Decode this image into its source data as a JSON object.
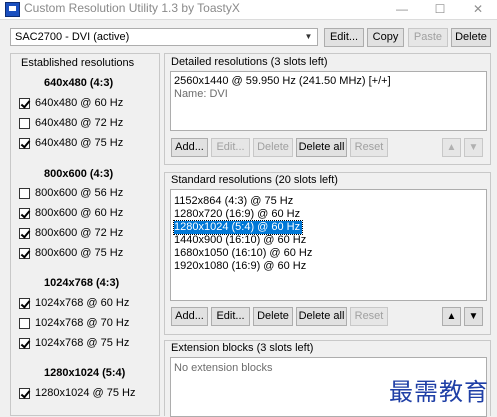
{
  "window": {
    "title": "Custom Resolution Utility 1.3 by ToastyX",
    "controls": {
      "minimize": "—",
      "maximize": "☐",
      "close": "✕"
    }
  },
  "display_select": {
    "value": "SAC2700 - DVI (active)"
  },
  "top_buttons": {
    "edit": "Edit...",
    "copy": "Copy",
    "paste": "Paste",
    "delete": "Delete"
  },
  "established": {
    "title": "Established resolutions",
    "groups": [
      {
        "heading": "640x480 (4:3)",
        "items": [
          {
            "label": "640x480 @ 60 Hz",
            "checked": true
          },
          {
            "label": "640x480 @ 72 Hz",
            "checked": false
          },
          {
            "label": "640x480 @ 75 Hz",
            "checked": true
          }
        ]
      },
      {
        "heading": "800x600 (4:3)",
        "items": [
          {
            "label": "800x600 @ 56 Hz",
            "checked": false
          },
          {
            "label": "800x600 @ 60 Hz",
            "checked": true
          },
          {
            "label": "800x600 @ 72 Hz",
            "checked": true
          },
          {
            "label": "800x600 @ 75 Hz",
            "checked": true
          }
        ]
      },
      {
        "heading": "1024x768 (4:3)",
        "items": [
          {
            "label": "1024x768 @ 60 Hz",
            "checked": true
          },
          {
            "label": "1024x768 @ 70 Hz",
            "checked": false
          },
          {
            "label": "1024x768 @ 75 Hz",
            "checked": true
          }
        ]
      },
      {
        "heading": "1280x1024 (5:4)",
        "items": [
          {
            "label": "1280x1024 @ 75 Hz",
            "checked": true
          }
        ]
      }
    ]
  },
  "detailed": {
    "title": "Detailed resolutions (3 slots left)",
    "lines": [
      "2560x1440 @ 59.950 Hz (241.50 MHz) [+/+]",
      "Name: DVI"
    ],
    "buttons": {
      "add": "Add...",
      "edit": "Edit...",
      "delete": "Delete",
      "delete_all": "Delete all",
      "reset": "Reset"
    }
  },
  "standard": {
    "title": "Standard resolutions (20 slots left)",
    "items": [
      "1152x864 (4:3) @ 75 Hz",
      "1280x720 (16:9) @ 60 Hz",
      "1280x1024 (5:4) @ 60 Hz",
      "1440x900 (16:10) @ 60 Hz",
      "1680x1050 (16:10) @ 60 Hz",
      "1920x1080 (16:9) @ 60 Hz"
    ],
    "selected_index": 2,
    "buttons": {
      "add": "Add...",
      "edit": "Edit...",
      "delete": "Delete",
      "delete_all": "Delete all",
      "reset": "Reset"
    }
  },
  "extension": {
    "title": "Extension blocks (3 slots left)",
    "empty_text": "No extension blocks"
  },
  "watermark": "最需教育",
  "icons": {
    "up": "▲",
    "down": "▼",
    "dropdown": "▼"
  }
}
